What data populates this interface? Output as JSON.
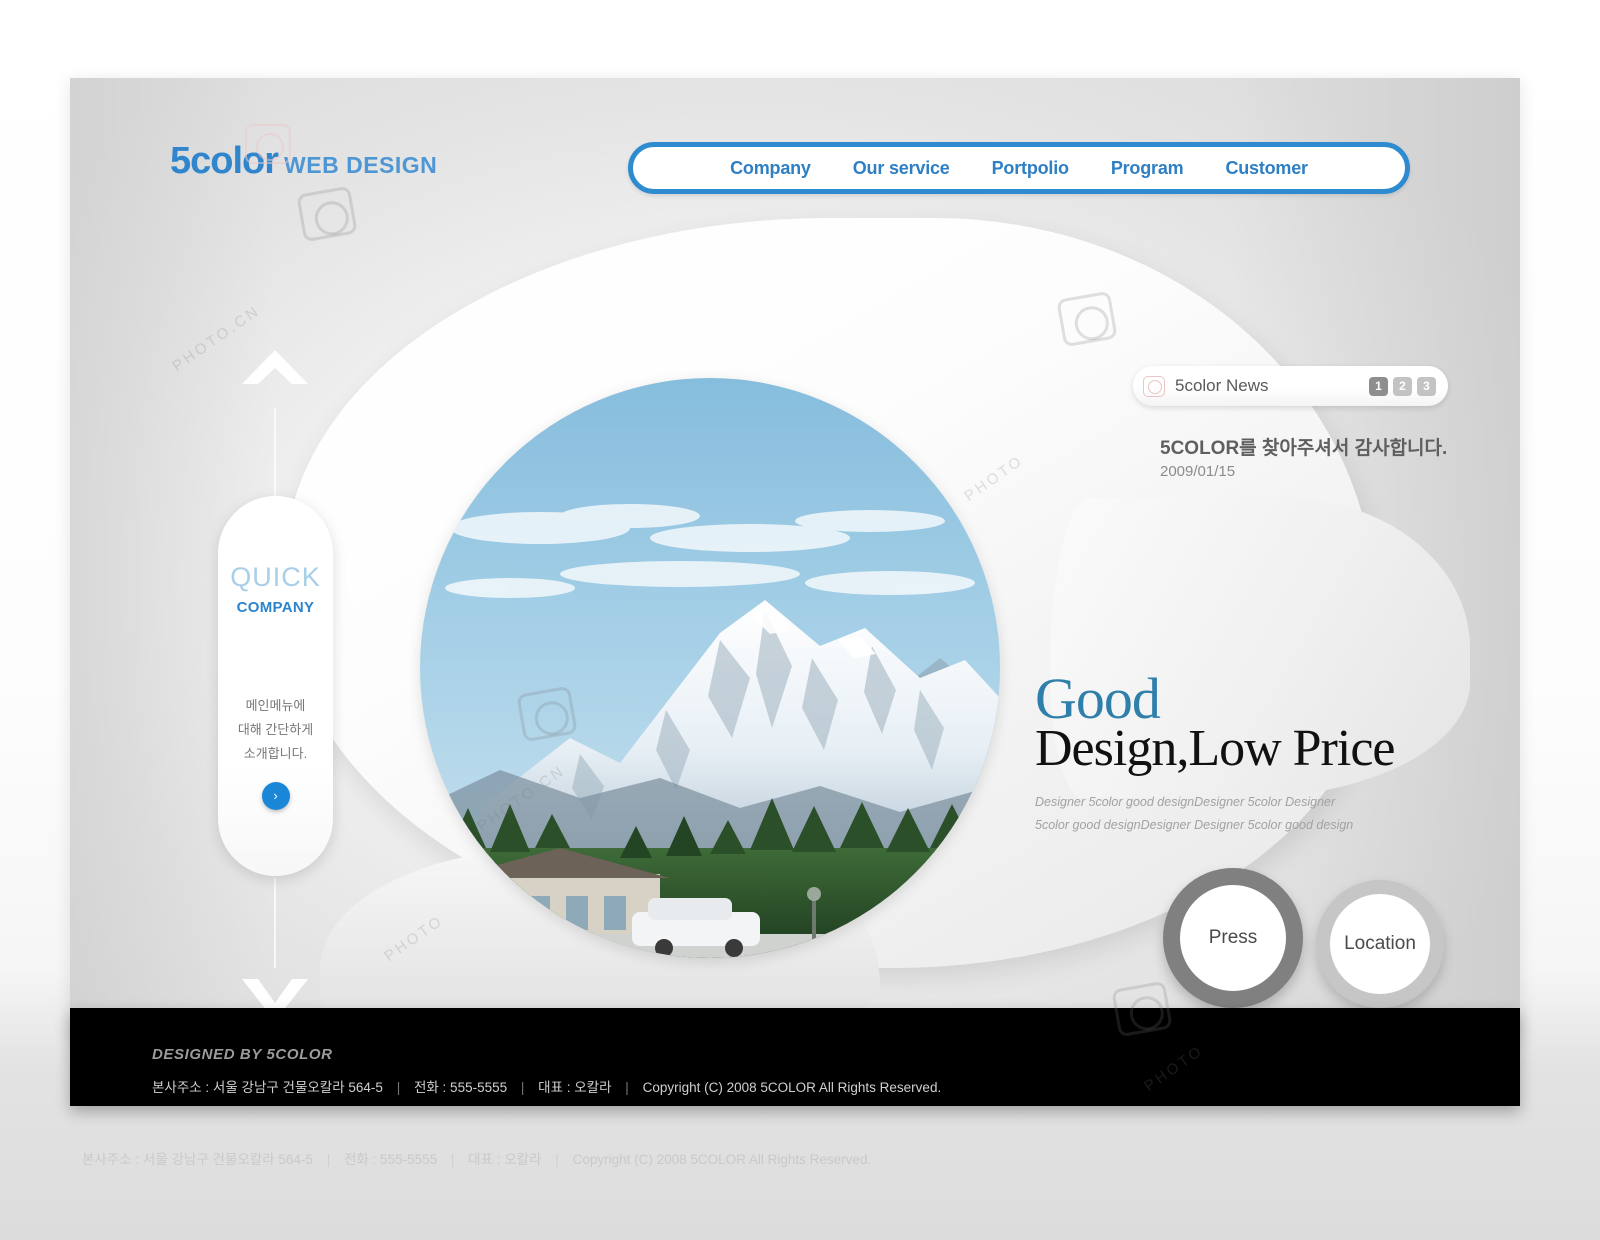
{
  "brand": {
    "logo_main": "5color",
    "logo_sub": "WEB DESIGN"
  },
  "nav": {
    "items": [
      {
        "label": "Company"
      },
      {
        "label": "Our service"
      },
      {
        "label": "Portpolio"
      },
      {
        "label": "Program"
      },
      {
        "label": "Customer"
      }
    ]
  },
  "quick": {
    "title": "QUICK",
    "subtitle": "COMPANY",
    "description": "메인메뉴에\n대해 간단하게\n소개합니다.",
    "go_label": "›",
    "arrow_up": "arrow-up-icon",
    "arrow_down": "arrow-down-icon"
  },
  "news": {
    "label": "5color News",
    "pages": [
      "1",
      "2",
      "3"
    ],
    "active_page": "1",
    "headline": "5COLOR를 찾아주셔서 감사합니다.",
    "date": "2009/01/15"
  },
  "hero": {
    "title_line1": "Good",
    "title_line2": "Design,Low Price",
    "subtext_line1": "Designer 5color good designDesigner 5color Designer",
    "subtext_line2": "5color good designDesigner  Designer 5color good design",
    "photo_alt": "snow-capped mountain with forest and building"
  },
  "circle_buttons": [
    {
      "label": "Press"
    },
    {
      "label": "Location"
    }
  ],
  "footer": {
    "brand": "DESIGNED BY 5COLOR",
    "address": "본사주소 : 서울 강남구 건물오칼라 564-5",
    "phone": "전화 : 555-5555",
    "ceo": "대표 : 오칼라",
    "copyright": "Copyright (C) 2008 5COLOR All Rights Reserved.",
    "separator": "|"
  },
  "watermarks": {
    "text_a": "PHOTO.CN",
    "text_b": "PHOTO",
    "text_c": "PHOTO.CN",
    "text_d": "PHOTO"
  },
  "colors": {
    "accent_blue": "#2e8bd0",
    "logo_blue": "#2f86cc",
    "heading_blue": "#2f7fab",
    "quick_light": "#a8cfe8",
    "footer_bg": "#000000"
  }
}
